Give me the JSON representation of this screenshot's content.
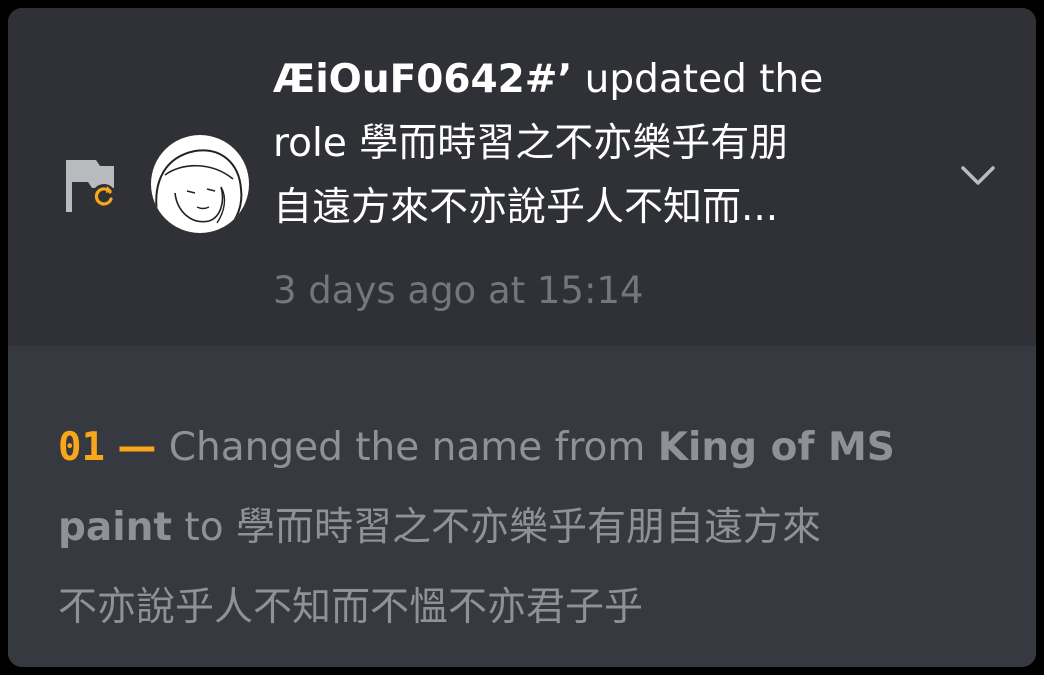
{
  "entry": {
    "username": "ÆiOuF0642#ʼ",
    "action_line1": " updated the",
    "action_line2": "role 學而時習之不亦樂乎有朋",
    "action_line3": "自遠方來不亦說乎人不知而...",
    "timestamp": "3 days ago at 15:14",
    "flag_icon": "role-update-flag-icon",
    "chevron_icon": "chevron-down-icon"
  },
  "change": {
    "number": "01",
    "dash": "—",
    "text_before": " Changed the name from ",
    "old_name_part1": "King of MS",
    "old_name_part2": "paint",
    "text_to": " to ",
    "new_name_part1": "學而時習之不亦樂乎有朋自遠方來",
    "new_name_part2": "不亦說乎人不知而不慍不亦君子乎"
  },
  "colors": {
    "background": "#000000",
    "header_bg": "#2f3136",
    "details_bg": "#36393f",
    "text_primary": "#ffffff",
    "text_muted": "#72767d",
    "text_change": "#8e9297",
    "accent_orange": "#faa61a"
  }
}
